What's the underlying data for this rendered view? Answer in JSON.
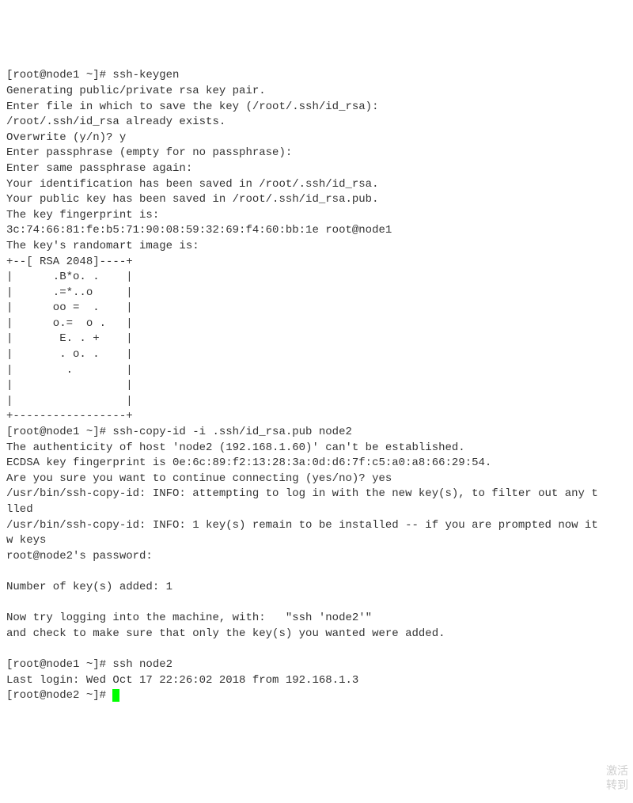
{
  "terminal": {
    "lines": [
      "[root@node1 ~]# ssh-keygen",
      "Generating public/private rsa key pair.",
      "Enter file in which to save the key (/root/.ssh/id_rsa):",
      "/root/.ssh/id_rsa already exists.",
      "Overwrite (y/n)? y",
      "Enter passphrase (empty for no passphrase):",
      "Enter same passphrase again:",
      "Your identification has been saved in /root/.ssh/id_rsa.",
      "Your public key has been saved in /root/.ssh/id_rsa.pub.",
      "The key fingerprint is:",
      "3c:74:66:81:fe:b5:71:90:08:59:32:69:f4:60:bb:1e root@node1",
      "The key's randomart image is:",
      "+--[ RSA 2048]----+",
      "|      .B*o. .    |",
      "|      .=*..o     |",
      "|      oo =  .    |",
      "|      o.=  o .   |",
      "|       E. . +    |",
      "|       . o. .    |",
      "|        .        |",
      "|                 |",
      "|                 |",
      "+-----------------+",
      "[root@node1 ~]# ssh-copy-id -i .ssh/id_rsa.pub node2",
      "The authenticity of host 'node2 (192.168.1.60)' can't be established.",
      "ECDSA key fingerprint is 0e:6c:89:f2:13:28:3a:0d:d6:7f:c5:a0:a8:66:29:54.",
      "Are you sure you want to continue connecting (yes/no)? yes",
      "/usr/bin/ssh-copy-id: INFO: attempting to log in with the new key(s), to filter out any t",
      "lled",
      "/usr/bin/ssh-copy-id: INFO: 1 key(s) remain to be installed -- if you are prompted now it",
      "w keys",
      "root@node2's password:",
      "",
      "Number of key(s) added: 1",
      "",
      "Now try logging into the machine, with:   \"ssh 'node2'\"",
      "and check to make sure that only the key(s) you wanted were added.",
      "",
      "[root@node1 ~]# ssh node2",
      "Last login: Wed Oct 17 22:26:02 2018 from 192.168.1.3"
    ],
    "final_prompt": "[root@node2 ~]# "
  },
  "watermark": {
    "line1": "激活",
    "line2": "转到"
  }
}
